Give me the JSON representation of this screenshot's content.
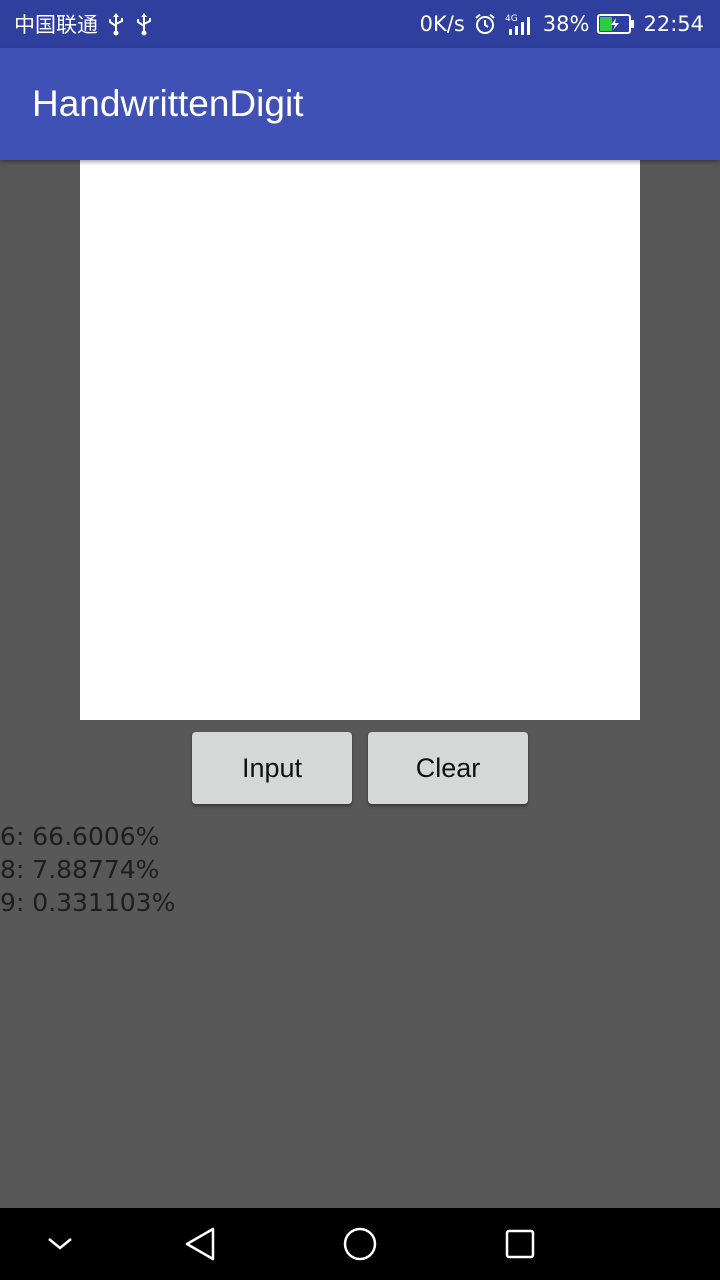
{
  "status_bar": {
    "carrier": "中国联通",
    "icons_left": [
      "usb-icon",
      "usb-icon"
    ],
    "net_speed": "0K/s",
    "network_type": "4G",
    "battery": "38%",
    "time": "22:54",
    "icons_right": [
      "alarm-icon",
      "signal-icon",
      "battery-charging-icon"
    ],
    "battery_color": "#2ecc40"
  },
  "app_bar": {
    "title": "HandwrittenDigit",
    "color": "#3f51b5"
  },
  "canvas": {
    "background": "#ffffff"
  },
  "buttons": {
    "input_label": "Input",
    "clear_label": "Clear"
  },
  "results": [
    "6: 66.6006%",
    "8: 7.88774%",
    "9: 0.331103%"
  ],
  "nav_bar": {
    "icons": [
      "chevron-down-icon",
      "back-icon",
      "home-icon",
      "recents-icon"
    ]
  }
}
